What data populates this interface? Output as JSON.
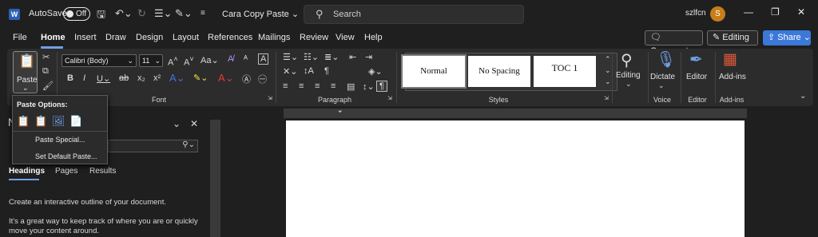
{
  "titlebar": {
    "app_logo": "W",
    "autosave_label": "AutoSave",
    "autosave_state": "Off",
    "document_title": "Cara Copy Paste ⌄",
    "search_placeholder": "Search",
    "user_name": "szlfcn",
    "avatar_initial": "S"
  },
  "menu": {
    "items": [
      "File",
      "Home",
      "Insert",
      "Draw",
      "Design",
      "Layout",
      "References",
      "Mailings",
      "Review",
      "View",
      "Help"
    ],
    "comments_label": "Comments",
    "editing_label": "Editing ⌄",
    "share_label": "Share ⌄"
  },
  "ribbon": {
    "paste_label": "Paste",
    "font_name": "Calibri (Body)",
    "font_size": "11",
    "font_group": "Font",
    "paragraph_group": "Paragraph",
    "styles_group": "Styles",
    "styles": [
      "Normal",
      "No Spacing",
      "TOC 1"
    ],
    "editing_label": "Editing",
    "dictate_label": "Dictate",
    "voice_group": "Voice",
    "editor_label": "Editor",
    "editor_group": "Editor",
    "addins_label": "Add-ins",
    "addins_group": "Add-ins"
  },
  "paste_menu": {
    "title": "Paste Options:",
    "items": [
      "Paste Special...",
      "Set Default Paste..."
    ]
  },
  "nav": {
    "title_initial": "N",
    "tabs": [
      "Headings",
      "Pages",
      "Results"
    ],
    "text1": "Create an interactive outline of your document.",
    "text2": "It's a great way to keep track of where you are or quickly move your content around."
  },
  "colors": {
    "accent_blue": "#3b78d8",
    "avatar": "#c77d19",
    "highlight_yellow": "#f5e13a",
    "font_red": "#e03a3a"
  }
}
